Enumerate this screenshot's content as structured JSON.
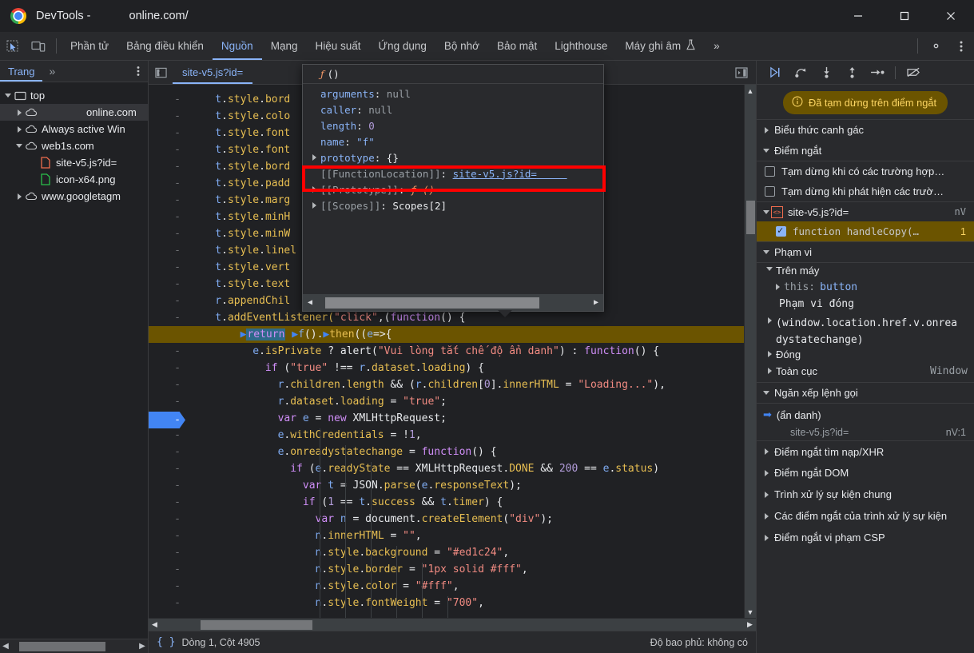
{
  "window": {
    "app_title": "DevTools -",
    "url": "online.com/",
    "minimize": "—",
    "maximize": "□",
    "close": "✕"
  },
  "main_tabs": {
    "inspect_icon": "inspect-element-icon",
    "device_icon": "device-toolbar-icon",
    "items": [
      {
        "label": "Phần tử",
        "active": false
      },
      {
        "label": "Bảng điều khiển",
        "active": false
      },
      {
        "label": "Nguồn",
        "active": true
      },
      {
        "label": "Mạng",
        "active": false
      },
      {
        "label": "Hiệu suất",
        "active": false
      },
      {
        "label": "Ứng dụng",
        "active": false
      },
      {
        "label": "Bộ nhớ",
        "active": false
      },
      {
        "label": "Bảo mật",
        "active": false
      },
      {
        "label": "Lighthouse",
        "active": false
      },
      {
        "label": "Máy ghi âm",
        "active": false,
        "flask": true
      }
    ],
    "overflow": "»",
    "settings_icon": "gear-icon",
    "more_icon": "kebab-menu-icon"
  },
  "navigator": {
    "tab_label": "Trang",
    "more_label": "»",
    "kebab": "⋮",
    "tree": [
      {
        "label": "top",
        "indent": 0,
        "expander": "down",
        "icon": "frame-icon",
        "selected": false
      },
      {
        "label": "online.com",
        "indent": 1,
        "expander": "right",
        "icon": "cloud-icon",
        "selected": true,
        "align_right": true
      },
      {
        "label": "Always active Win",
        "indent": 1,
        "expander": "right",
        "icon": "cloud-icon",
        "selected": false
      },
      {
        "label": "web1s.com",
        "indent": 1,
        "expander": "down",
        "icon": "cloud-icon",
        "selected": false
      },
      {
        "label": "site-v5.js?id=",
        "indent": 2,
        "expander": "none",
        "icon": "js-file-icon",
        "selected": false
      },
      {
        "label": "icon-x64.png",
        "indent": 2,
        "expander": "none",
        "icon": "image-file-icon",
        "selected": false
      },
      {
        "label": "www.googletagm",
        "indent": 1,
        "expander": "right",
        "icon": "cloud-icon",
        "selected": false
      }
    ]
  },
  "editor": {
    "collapse_icon": "collapse-sidebar-icon",
    "tab_label": "site-v5.js?id=",
    "expand_icon": "show-debugger-icon",
    "gutter_symbol": "-",
    "lines": [
      {
        "text": "t.style.bord",
        "truncated": true
      },
      {
        "text": "t.style.colo",
        "truncated": true
      },
      {
        "text": "t.style.font",
        "truncated": true
      },
      {
        "text": "t.style.font",
        "truncated": true
      },
      {
        "text": "t.style.bord",
        "truncated": true
      },
      {
        "text": "t.style.padd",
        "truncated": true
      },
      {
        "text": "t.style.marg",
        "truncated": true
      },
      {
        "text": "t.style.minH",
        "truncated": true
      },
      {
        "text": "t.style.minW",
        "truncated": true
      },
      {
        "text": "t.style.linel",
        "truncated": true
      },
      {
        "text": "t.style.vert",
        "truncated": true
      },
      {
        "text": "t.style.text",
        "truncated": true
      },
      {
        "text": "r.appendChil",
        "truncated": true
      },
      {
        "text": "t.addEventListener(\"click\",(function() {",
        "truncated": false
      }
    ],
    "highlighted_line": "return f().then((e=>{",
    "code_body": [
      "e.isPrivate ? alert(\"Vui lòng tắt chế độ ẩn danh\") : function() {",
      "if (\"true\" !== r.dataset.loading) {",
      "r.children.length && (r.children[0].innerHTML = \"Loading...\"),",
      "r.dataset.loading = \"true\";",
      "var e = new XMLHttpRequest;",
      "e.withCredentials = !1,",
      "e.onreadystatechange = function() {",
      "if (e.readyState == XMLHttpRequest.DONE && 200 == e.status)",
      "var t = JSON.parse(e.responseText);",
      "if (1 == t.success && t.timer) {",
      "var n = document.createElement(\"div\");",
      "n.innerHTML = \"\",",
      "n.style.background = \"#ed1c24\",",
      "n.style.border = \"1px solid #fff\",",
      "n.style.color = \"#fff\",",
      "n.style.fontWeight = \"700\","
    ],
    "status": {
      "braces_icon": "format-braces-icon",
      "position": "Dòng 1, Cột 4905",
      "coverage": "Độ bao phủ: không có"
    }
  },
  "object_popup": {
    "title": "ƒ ()",
    "rows": [
      {
        "expander": "none",
        "key": "arguments",
        "key_color": "blue",
        "sep": ": ",
        "value": "null",
        "value_type": "null"
      },
      {
        "expander": "none",
        "key": "caller",
        "key_color": "blue",
        "sep": ": ",
        "value": "null",
        "value_type": "null"
      },
      {
        "expander": "none",
        "key": "length",
        "key_color": "blue",
        "sep": ": ",
        "value": "0",
        "value_type": "num"
      },
      {
        "expander": "none",
        "key": "name",
        "key_color": "blue",
        "sep": ": ",
        "value": "\"f\"",
        "value_type": "str"
      },
      {
        "expander": "right",
        "key": "prototype",
        "key_color": "blue",
        "sep": ": ",
        "value": "{}",
        "value_type": "plain"
      },
      {
        "expander": "none",
        "key": "[[FunctionLocation]]",
        "key_color": "gray",
        "sep": ": ",
        "value": "site-v5.js?id=",
        "value_type": "link",
        "highlighted": true
      },
      {
        "expander": "right",
        "key": "[[Prototype]]",
        "key_color": "gray",
        "sep": ": ",
        "value": "ƒ ()",
        "value_type": "func"
      },
      {
        "expander": "right",
        "key": "[[Scopes]]",
        "key_color": "gray",
        "sep": ": ",
        "value": "Scopes[2]",
        "value_type": "plain"
      }
    ]
  },
  "debugger": {
    "toolbar": [
      {
        "name": "resume-button",
        "glyph": "▶|",
        "accent": true
      },
      {
        "name": "step-over-button",
        "glyph": "⤻"
      },
      {
        "name": "step-into-button",
        "glyph": "↓"
      },
      {
        "name": "step-out-button",
        "glyph": "↑"
      },
      {
        "name": "step-button",
        "glyph": "→•"
      },
      {
        "name": "deactivate-breakpoints-button",
        "glyph": "⃠"
      }
    ],
    "paused_banner": {
      "icon": "info-icon",
      "text": "Đã tạm dừng trên điểm ngắt"
    },
    "watch_section": "Biểu thức canh gác",
    "breakpoints_section": "Điểm ngắt",
    "pause_options": [
      {
        "label": "Tạm dừng khi có các trường hợp…",
        "checked": false
      },
      {
        "label": "Tạm dừng khi phát hiện các trườ…",
        "checked": false
      }
    ],
    "breakpoint_file": {
      "name": "site-v5.js?id=",
      "right": "nV"
    },
    "breakpoint_item": {
      "label": "function handleCopy(…",
      "line": "1",
      "checked": true
    },
    "scope_section": "Phạm vi",
    "scope_rows": [
      {
        "label": "Trên máy",
        "expander": "down",
        "indent": 0,
        "type": "group"
      },
      {
        "label": "this:",
        "value": "button",
        "expander": "right",
        "indent": 1,
        "type": "prop"
      },
      {
        "label": "Phạm vi đóng",
        "expander": "none",
        "indent": 1,
        "type": "text"
      },
      {
        "label": "(window.location.href.v.onrea dystatechange)",
        "expander": "right",
        "indent": 0,
        "type": "text"
      },
      {
        "label": "Đóng",
        "expander": "right",
        "indent": 0,
        "type": "text"
      },
      {
        "label": "Toàn cục",
        "value": "Window",
        "expander": "right",
        "indent": 0,
        "type": "text"
      }
    ],
    "callstack_section": "Ngăn xếp lệnh gọi",
    "callstack": [
      {
        "name": "(ẩn danh)",
        "file": "site-v5.js?id=",
        "loc": "nV:1",
        "active": true
      }
    ],
    "other_sections": [
      "Điểm ngắt tìm nạp/XHR",
      "Điểm ngắt DOM",
      "Trình xử lý sự kiện chung",
      "Các điểm ngắt của trình xử lý sự kiện",
      "Điểm ngắt vi phạm CSP"
    ]
  },
  "colors": {
    "accent_blue": "#8ab4f8",
    "paused_yellow": "#6b5400",
    "banner_text": "#fdd663",
    "highlight_red": "#ff0000",
    "bg": "#202124",
    "panel_bg": "#292a2d"
  }
}
